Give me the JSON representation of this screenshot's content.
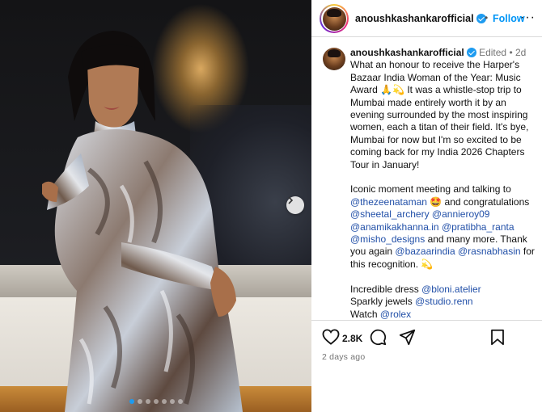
{
  "post": {
    "username": "anoushkashankarofficial",
    "follow_label": "Follow",
    "header_separator": "•",
    "more_label": "···",
    "caption": {
      "username": "anoushkashankarofficial",
      "edited": "Edited",
      "separator": "•",
      "age": "2d",
      "p1_text1": "What an honour to receive the Harper's Bazaar India Woman of the Year: Music Award 🙏💫 It was a whistle-stop trip to Mumbai made entirely worth it by an evening surrounded by the most inspiring women, each a titan of their field. It's bye, Mumbai for now but I'm so excited to be coming back for my India 2026 Chapters Tour in January!",
      "p2_text1": "Iconic moment meeting and talking to",
      "m_zeenat": "@thezeenataman",
      "p2_text2": "🤩 and congratulations",
      "m_sheetal": "@sheetal_archery",
      "m_annie": "@annieroy09",
      "m_anamika": "@anamikakhanna.in",
      "m_pratibha": "@pratibha_ranta",
      "m_misho": "@misho_designs",
      "p2_text3": "and many more. Thank you again",
      "m_bazaar": "@bazaarindia",
      "m_rasna": "@rasnabhasin",
      "p2_text4": "for this recognition. 💫",
      "l1_text": "Incredible dress",
      "m_bloni": "@bloni.atelier",
      "l2_text": "Sparkly jewels",
      "m_studio": "@studio.renn",
      "l3_text": "Watch",
      "m_rolex": "@rolex"
    },
    "likes": "2.8K",
    "time_ago": "2 days ago",
    "carousel": {
      "slide_count": 7,
      "active_index": 0
    }
  },
  "icons": {
    "next": "chevron-right-icon",
    "like": "heart-icon",
    "comment": "comment-bubble-icon",
    "share": "paper-plane-icon",
    "save": "bookmark-icon",
    "verified": "verified-badge-icon"
  },
  "colors": {
    "follow": "#0095f6",
    "mention": "#2250a8",
    "verified": "#1d9bf0"
  }
}
